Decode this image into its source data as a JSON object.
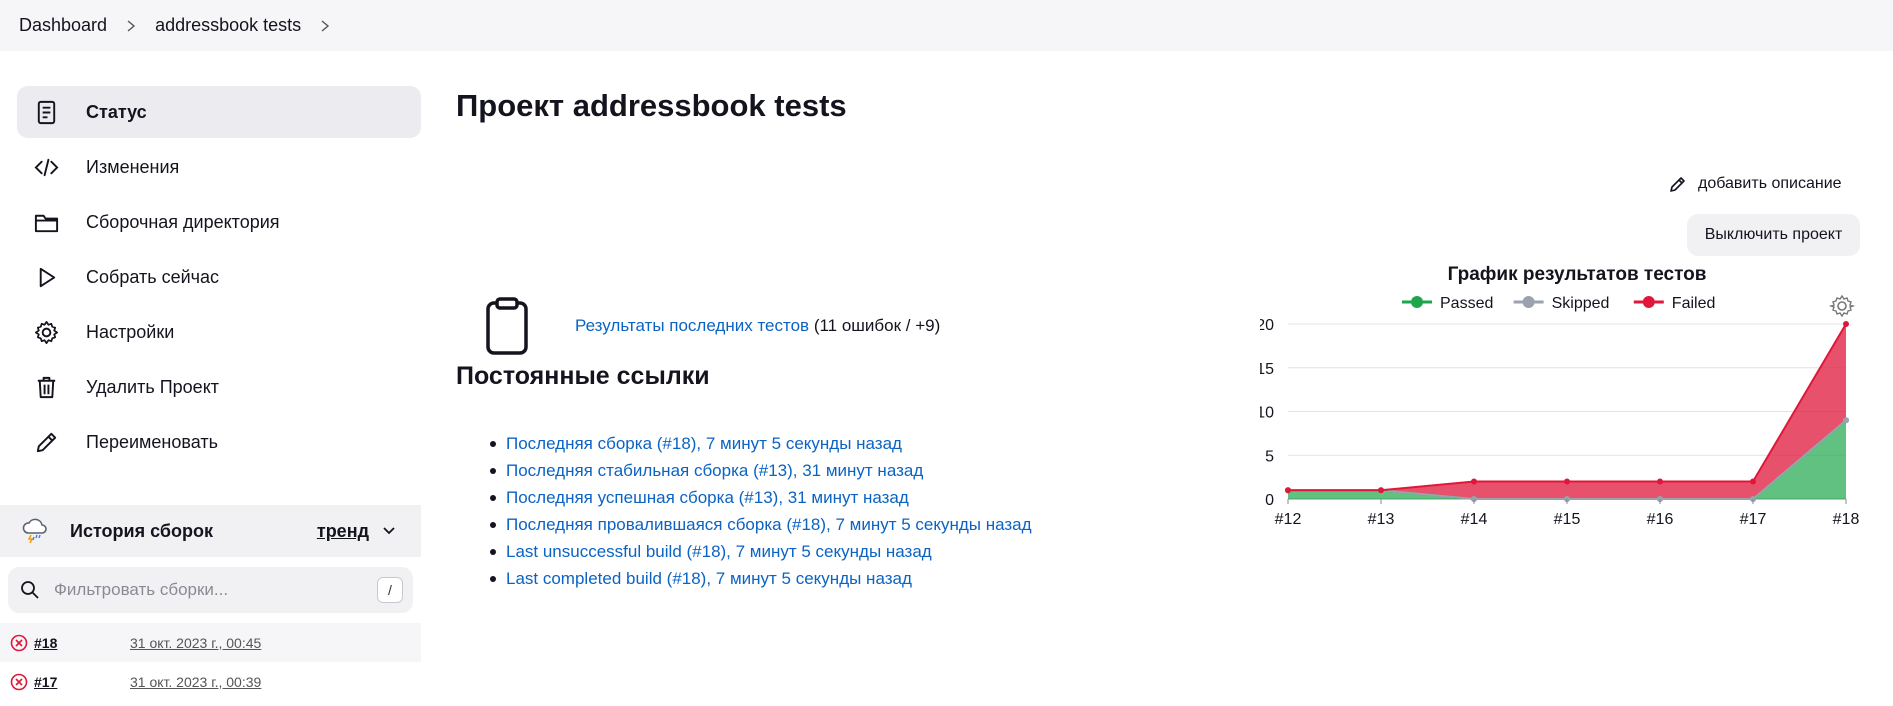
{
  "breadcrumb": {
    "items": [
      "Dashboard",
      "addressbook tests"
    ]
  },
  "sidebar": {
    "items": [
      {
        "label": "Статус",
        "icon": "status-icon",
        "active": true
      },
      {
        "label": "Изменения",
        "icon": "code-icon"
      },
      {
        "label": "Сборочная директория",
        "icon": "folder-icon"
      },
      {
        "label": "Собрать сейчас",
        "icon": "play-icon"
      },
      {
        "label": "Настройки",
        "icon": "gear-icon"
      },
      {
        "label": "Удалить Проект",
        "icon": "trash-icon"
      },
      {
        "label": "Переименовать",
        "icon": "pencil-icon"
      }
    ]
  },
  "history": {
    "title": "История сборок",
    "trend_label": "тренд",
    "filter_placeholder": "Фильтровать сборки...",
    "shortcut": "/",
    "builds": [
      {
        "number": "#18",
        "time": "31 окт. 2023 г., 00:45",
        "status": "failed"
      },
      {
        "number": "#17",
        "time": "31 окт. 2023 г., 00:39",
        "status": "failed"
      }
    ]
  },
  "main": {
    "title": "Проект addressbook tests",
    "add_description": "добавить описание",
    "disable_button": "Выключить проект",
    "test_results_link": "Результаты последних тестов",
    "test_results_summary": "(11 ошибок / +9)",
    "permalinks_title": "Постоянные ссылки",
    "permalinks": [
      "Последняя сборка (#18), 7 минут 5 секунды назад",
      "Последняя стабильная сборка (#13), 31 минут назад",
      "Последняя успешная сборка (#13), 31 минут назад",
      "Последняя провалившаяся сборка (#18), 7 минут 5 секунды назад",
      "Last unsuccessful build (#18), 7 минут 5 секунды назад",
      "Last completed build (#18), 7 минут 5 секунды назад"
    ]
  },
  "colors": {
    "passed": "#1ea64b",
    "skipped": "#9aa3ad",
    "failed": "#e0173a",
    "link": "#0b63c4"
  },
  "chart_data": {
    "type": "area",
    "title": "График результатов тестов",
    "categories": [
      "#12",
      "#13",
      "#14",
      "#15",
      "#16",
      "#17",
      "#18"
    ],
    "series": [
      {
        "name": "Passed",
        "values": [
          1,
          1,
          0,
          0,
          0,
          0,
          9
        ]
      },
      {
        "name": "Skipped",
        "values": [
          0,
          0,
          0,
          0,
          0,
          0,
          0
        ]
      },
      {
        "name": "Failed",
        "values": [
          0,
          0,
          2,
          2,
          2,
          2,
          11
        ]
      }
    ],
    "stacked": true,
    "ylim": [
      0,
      20
    ],
    "yticks": [
      0,
      5,
      10,
      15,
      20
    ],
    "legend": "top",
    "grid": true
  }
}
